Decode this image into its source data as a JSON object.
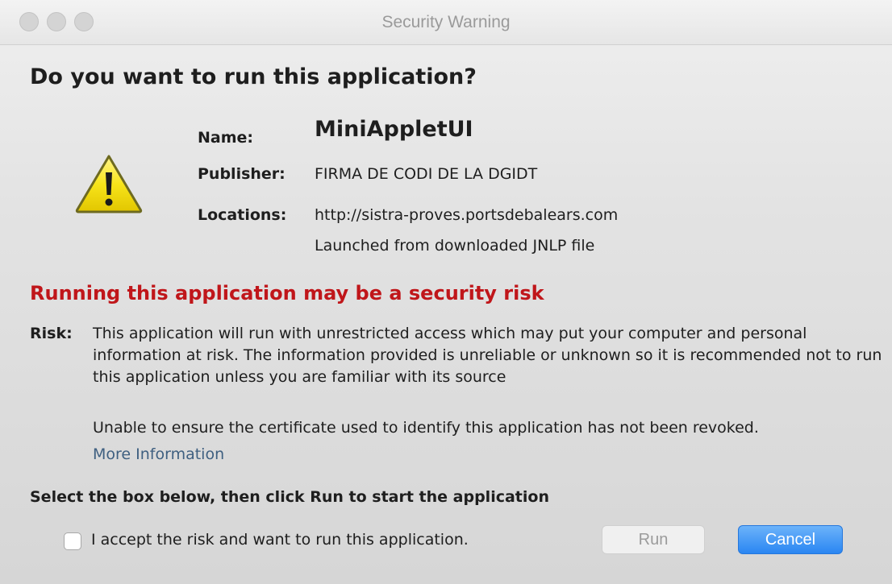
{
  "window": {
    "title": "Security Warning"
  },
  "headline": "Do you want to run this application?",
  "app_info": {
    "name_label": "Name:",
    "name_value": "MiniAppletUI",
    "publisher_label": "Publisher:",
    "publisher_value": "FIRMA DE CODI DE LA DGIDT",
    "locations_label": "Locations:",
    "location_url": "http://sistra-proves.portsdebalears.com",
    "location_source": "Launched from downloaded JNLP file"
  },
  "risk": {
    "title": "Running this application may be a security risk",
    "label": "Risk:",
    "description": "This application will run with unrestricted access which may put your computer and personal information at risk. The information provided is unreliable or unknown so it is recommended not to run this application unless you are familiar with its source",
    "revocation_note": "Unable to ensure the certificate used to identify this application has not been revoked.",
    "more_info_link": "More Information"
  },
  "accept": {
    "instruction": "Select the box below, then click Run to start the application",
    "checkbox_label": "I accept the risk and want to run this application.",
    "checked": false
  },
  "buttons": {
    "run_label": "Run",
    "cancel_label": "Cancel"
  },
  "icons": {
    "warning": "warning-triangle-icon"
  },
  "colors": {
    "risk_red": "#c0161a",
    "link_blue": "#3e5f80",
    "primary_button": "#2a86f2",
    "warning_yellow": "#f4e000"
  }
}
